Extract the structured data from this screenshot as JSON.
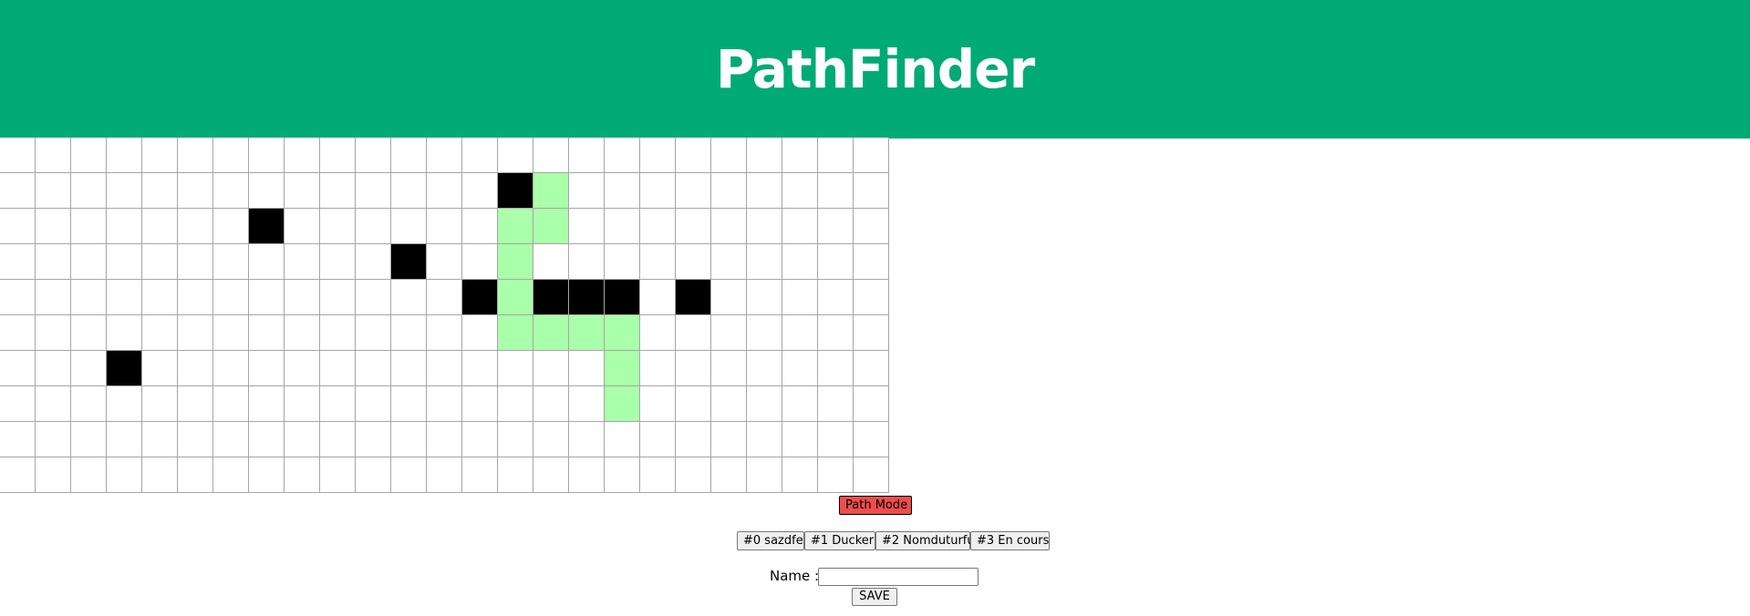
{
  "header": {
    "title": "PathFinder",
    "bg_color": "#00aa75"
  },
  "grid": {
    "rows": 10,
    "cols": 25,
    "wall_color": "#000000",
    "path_color": "#aaffaa",
    "walls": [
      [
        1,
        14
      ],
      [
        2,
        7
      ],
      [
        3,
        11
      ],
      [
        4,
        13
      ],
      [
        4,
        15
      ],
      [
        4,
        16
      ],
      [
        4,
        17
      ],
      [
        4,
        19
      ],
      [
        6,
        3
      ]
    ],
    "path": [
      [
        1,
        15
      ],
      [
        2,
        14
      ],
      [
        2,
        15
      ],
      [
        3,
        14
      ],
      [
        4,
        14
      ],
      [
        5,
        14
      ],
      [
        5,
        15
      ],
      [
        5,
        16
      ],
      [
        5,
        17
      ],
      [
        6,
        17
      ],
      [
        7,
        17
      ]
    ]
  },
  "controls": {
    "mode_label": "Path Mode",
    "mode_color": "#ee4d4d",
    "saves": [
      "#0 sazdfe",
      "#1 Ducker",
      "#2 Nomduturfu",
      "#3 En cours"
    ],
    "name_label": "Name :",
    "name_value": "",
    "save_label": "SAVE"
  }
}
